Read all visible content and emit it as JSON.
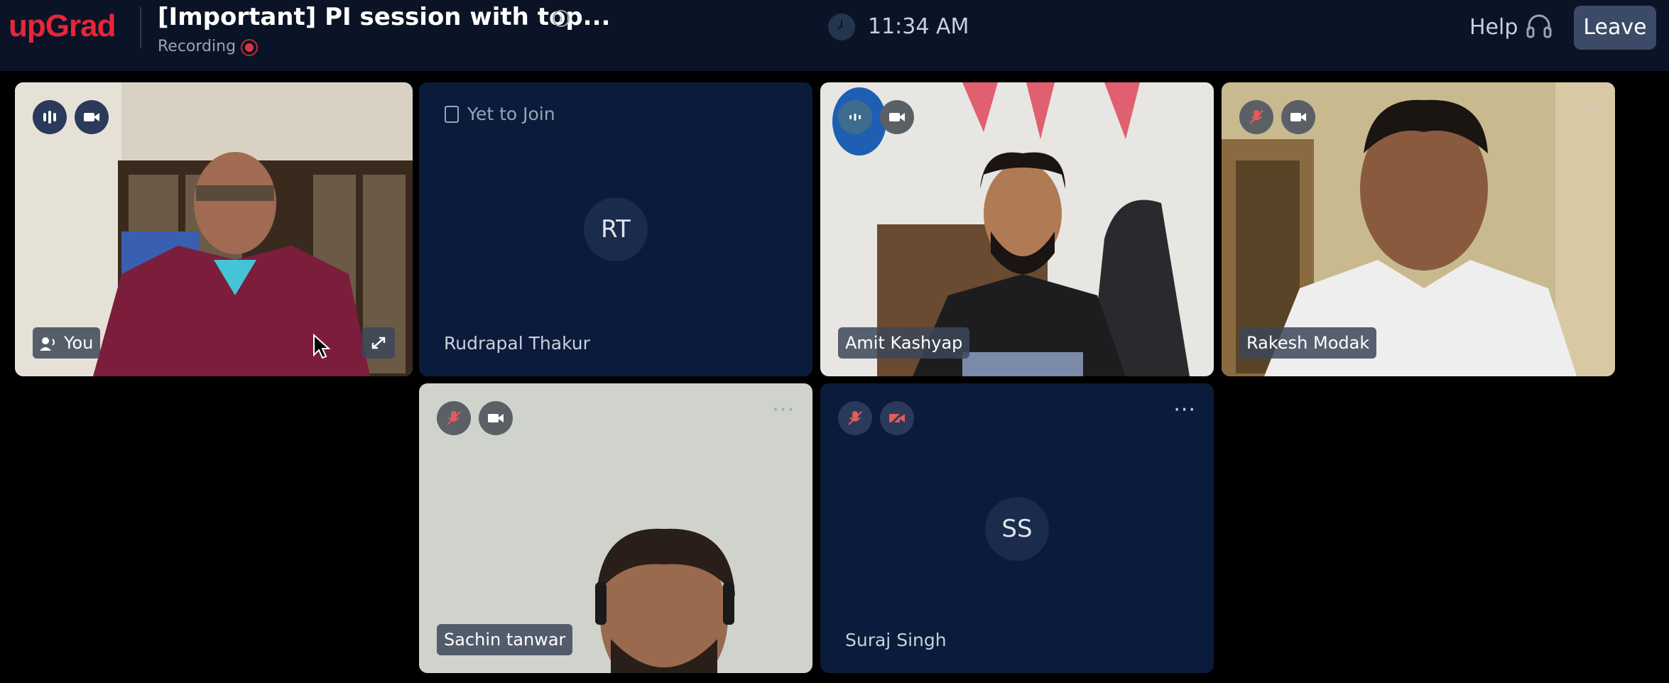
{
  "header": {
    "logo": "upGrad",
    "title": "[Important] PI session with top...",
    "info_icon": "i",
    "recording_label": "Recording",
    "time": "11:34 AM",
    "help_label": "Help",
    "leave_label": "Leave"
  },
  "tiles": [
    {
      "name": "You",
      "initials": "",
      "state": "video",
      "mic": "active",
      "camera": "on"
    },
    {
      "name": "Rudrapal Thakur",
      "initials": "RT",
      "state": "Yet to Join"
    },
    {
      "name": "Amit Kashyap",
      "initials": "",
      "state": "video",
      "mic": "active",
      "camera": "on"
    },
    {
      "name": "Rakesh Modak",
      "initials": "",
      "state": "video",
      "mic": "muted",
      "camera": "on"
    },
    {
      "name": "Sachin tanwar",
      "initials": "",
      "state": "video",
      "mic": "muted",
      "camera": "on"
    },
    {
      "name": "Suraj Singh",
      "initials": "SS",
      "state": "avatar",
      "mic": "muted",
      "camera": "off"
    }
  ],
  "colors": {
    "brand": "#e8253a",
    "header_bg": "#0a1426",
    "tile_bg": "#0b1b3b",
    "recording": "#d83446"
  }
}
